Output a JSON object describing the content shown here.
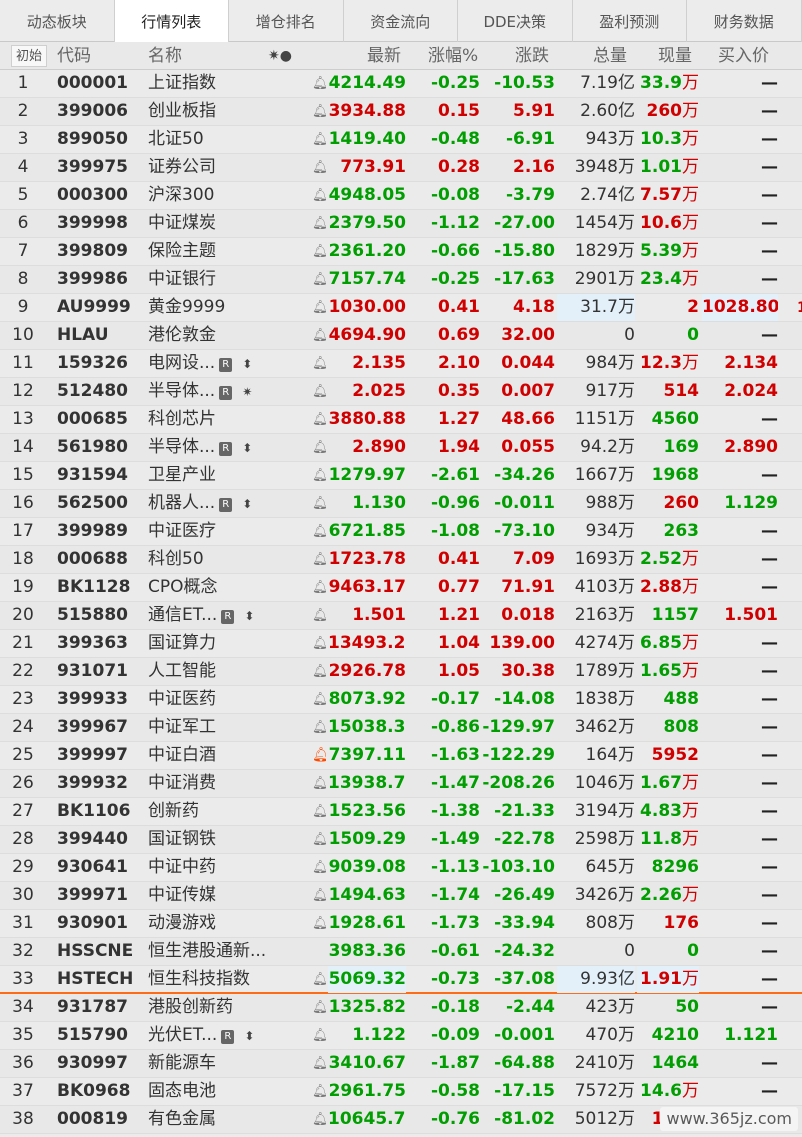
{
  "tabs": [
    {
      "label": "动态板块",
      "active": false
    },
    {
      "label": "行情列表",
      "active": true
    },
    {
      "label": "增仓排名",
      "active": false
    },
    {
      "label": "资金流向",
      "active": false
    },
    {
      "label": "DDE决策",
      "active": false
    },
    {
      "label": "盈利预测",
      "active": false
    },
    {
      "label": "财务数据",
      "active": false
    }
  ],
  "header": {
    "first": "初始",
    "code": "代码",
    "name": "名称",
    "marks": "✷●",
    "price": "最新",
    "pct": "涨幅%",
    "chg": "涨跌",
    "volume": "总量",
    "current": "现量",
    "bid": "买入价"
  },
  "colors": {
    "up": "#d00000",
    "down": "#009e00",
    "separator": "#ff6c17"
  },
  "icons": {
    "bell": "bell-icon",
    "badge": "r-badge-icon"
  },
  "rows": [
    {
      "idx": "1",
      "code": "000001",
      "name": "上证指数",
      "price": "4214.49",
      "pct": "-0.25",
      "chg": "-10.53",
      "vol": "7.19",
      "vol_unit": "亿",
      "cur": "33.9",
      "cur_unit": "万",
      "bid": "—",
      "dir": "down"
    },
    {
      "idx": "2",
      "code": "399006",
      "name": "创业板指",
      "price": "3934.88",
      "pct": "0.15",
      "chg": "5.91",
      "vol": "2.60",
      "vol_unit": "亿",
      "cur": "260",
      "cur_unit": "万",
      "bid": "—",
      "dir": "up"
    },
    {
      "idx": "3",
      "code": "899050",
      "name": "北证50",
      "price": "1419.40",
      "pct": "-0.48",
      "chg": "-6.91",
      "vol": "943",
      "vol_unit": "万",
      "cur": "10.3",
      "cur_unit": "万",
      "bid": "—",
      "dir": "down"
    },
    {
      "idx": "4",
      "code": "399975",
      "name": "证券公司",
      "price": "773.91",
      "pct": "0.28",
      "chg": "2.16",
      "vol": "3948",
      "vol_unit": "万",
      "cur": "1.01",
      "cur_unit": "万",
      "bid": "—",
      "dir": "up"
    },
    {
      "idx": "5",
      "code": "000300",
      "name": "沪深300",
      "price": "4948.05",
      "pct": "-0.08",
      "chg": "-3.79",
      "vol": "2.74",
      "vol_unit": "亿",
      "cur": "7.57",
      "cur_unit": "万",
      "bid": "—",
      "dir": "down"
    },
    {
      "idx": "6",
      "code": "399998",
      "name": "中证煤炭",
      "price": "2379.50",
      "pct": "-1.12",
      "chg": "-27.00",
      "vol": "1454",
      "vol_unit": "万",
      "cur": "10.6",
      "cur_unit": "万",
      "bid": "—",
      "dir": "down"
    },
    {
      "idx": "7",
      "code": "399809",
      "name": "保险主题",
      "price": "2361.20",
      "pct": "-0.66",
      "chg": "-15.80",
      "vol": "1829",
      "vol_unit": "万",
      "cur": "5.39",
      "cur_unit": "万",
      "bid": "—",
      "dir": "down"
    },
    {
      "idx": "8",
      "code": "399986",
      "name": "中证银行",
      "price": "7157.74",
      "pct": "-0.25",
      "chg": "-17.63",
      "vol": "2901",
      "vol_unit": "万",
      "cur": "23.4",
      "cur_unit": "万",
      "bid": "—",
      "dir": "down"
    },
    {
      "idx": "9",
      "code": "AU9999",
      "name": "黄金9999",
      "price": "1030.00",
      "pct": "0.41",
      "chg": "4.18",
      "vol": "31.7",
      "vol_unit": "万",
      "cur": "2",
      "cur_unit": "",
      "bid": "1028.80",
      "dir": "up"
    },
    {
      "idx": "10",
      "code": "HLAU",
      "name": "港伦敦金",
      "price": "4694.90",
      "pct": "0.69",
      "chg": "32.00",
      "vol": "0",
      "vol_unit": "",
      "cur": "0",
      "cur_unit": "",
      "bid": "—",
      "dir": "up"
    },
    {
      "idx": "11",
      "code": "159326",
      "name": "电网设...",
      "badge": "R",
      "mark": "⬍",
      "price": "2.135",
      "pct": "2.10",
      "chg": "0.044",
      "vol": "984",
      "vol_unit": "万",
      "cur": "12.3",
      "cur_unit": "万",
      "bid": "2.134",
      "dir": "up"
    },
    {
      "idx": "12",
      "code": "512480",
      "name": "半导体...",
      "badge": "R",
      "mark": "✷",
      "price": "2.025",
      "pct": "0.35",
      "chg": "0.007",
      "vol": "917",
      "vol_unit": "万",
      "cur": "514",
      "cur_unit": "",
      "bid": "2.024",
      "dir": "up"
    },
    {
      "idx": "13",
      "code": "000685",
      "name": "科创芯片",
      "price": "3880.88",
      "pct": "1.27",
      "chg": "48.66",
      "vol": "1151",
      "vol_unit": "万",
      "cur": "4560",
      "cur_unit": "",
      "bid": "—",
      "dir": "up"
    },
    {
      "idx": "14",
      "code": "561980",
      "name": "半导体...",
      "badge": "R",
      "mark": "⬍",
      "price": "2.890",
      "pct": "1.94",
      "chg": "0.055",
      "vol": "94.2",
      "vol_unit": "万",
      "cur": "169",
      "cur_unit": "",
      "bid": "2.890",
      "dir": "up"
    },
    {
      "idx": "15",
      "code": "931594",
      "name": "卫星产业",
      "price": "1279.97",
      "pct": "-2.61",
      "chg": "-34.26",
      "vol": "1667",
      "vol_unit": "万",
      "cur": "1968",
      "cur_unit": "",
      "bid": "—",
      "dir": "down"
    },
    {
      "idx": "16",
      "code": "562500",
      "name": "机器人...",
      "badge": "R",
      "mark": "⬍",
      "price": "1.130",
      "pct": "-0.96",
      "chg": "-0.011",
      "vol": "988",
      "vol_unit": "万",
      "cur": "260",
      "cur_unit": "",
      "bid": "1.129",
      "dir": "down"
    },
    {
      "idx": "17",
      "code": "399989",
      "name": "中证医疗",
      "price": "6721.85",
      "pct": "-1.08",
      "chg": "-73.10",
      "vol": "934",
      "vol_unit": "万",
      "cur": "263",
      "cur_unit": "",
      "bid": "—",
      "dir": "down"
    },
    {
      "idx": "18",
      "code": "000688",
      "name": "科创50",
      "price": "1723.78",
      "pct": "0.41",
      "chg": "7.09",
      "vol": "1693",
      "vol_unit": "万",
      "cur": "2.52",
      "cur_unit": "万",
      "bid": "—",
      "dir": "up"
    },
    {
      "idx": "19",
      "code": "BK1128",
      "name": "CPO概念",
      "price": "9463.17",
      "pct": "0.77",
      "chg": "71.91",
      "vol": "4103",
      "vol_unit": "万",
      "cur": "2.88",
      "cur_unit": "万",
      "bid": "—",
      "dir": "up"
    },
    {
      "idx": "20",
      "code": "515880",
      "name": "通信ET...",
      "badge": "R",
      "mark": "⬍",
      "price": "1.501",
      "pct": "1.21",
      "chg": "0.018",
      "vol": "2163",
      "vol_unit": "万",
      "cur": "1157",
      "cur_unit": "",
      "bid": "1.501",
      "dir": "up"
    },
    {
      "idx": "21",
      "code": "399363",
      "name": "国证算力",
      "price": "13493.22",
      "pct": "1.04",
      "chg": "139.00",
      "vol": "4274",
      "vol_unit": "万",
      "cur": "6.85",
      "cur_unit": "万",
      "bid": "—",
      "dir": "up"
    },
    {
      "idx": "22",
      "code": "931071",
      "name": "人工智能",
      "price": "2926.78",
      "pct": "1.05",
      "chg": "30.38",
      "vol": "1789",
      "vol_unit": "万",
      "cur": "1.65",
      "cur_unit": "万",
      "bid": "—",
      "dir": "up"
    },
    {
      "idx": "23",
      "code": "399933",
      "name": "中证医药",
      "price": "8073.92",
      "pct": "-0.17",
      "chg": "-14.08",
      "vol": "1838",
      "vol_unit": "万",
      "cur": "488",
      "cur_unit": "",
      "bid": "—",
      "dir": "down"
    },
    {
      "idx": "24",
      "code": "399967",
      "name": "中证军工",
      "price": "15038.31",
      "pct": "-0.86",
      "chg": "-129.97",
      "vol": "3462",
      "vol_unit": "万",
      "cur": "808",
      "cur_unit": "",
      "bid": "—",
      "dir": "down"
    },
    {
      "idx": "25",
      "code": "399997",
      "name": "中证白酒",
      "price": "7397.11",
      "pct": "-1.63",
      "chg": "-122.29",
      "vol": "164",
      "vol_unit": "万",
      "cur": "5952",
      "cur_unit": "",
      "bid": "—",
      "dir": "down",
      "alert": true
    },
    {
      "idx": "26",
      "code": "399932",
      "name": "中证消费",
      "price": "13938.71",
      "pct": "-1.47",
      "chg": "-208.26",
      "vol": "1046",
      "vol_unit": "万",
      "cur": "1.67",
      "cur_unit": "万",
      "bid": "—",
      "dir": "down"
    },
    {
      "idx": "27",
      "code": "BK1106",
      "name": "创新药",
      "price": "1523.56",
      "pct": "-1.38",
      "chg": "-21.33",
      "vol": "3194",
      "vol_unit": "万",
      "cur": "4.83",
      "cur_unit": "万",
      "bid": "—",
      "dir": "down"
    },
    {
      "idx": "28",
      "code": "399440",
      "name": "国证钢铁",
      "price": "1509.29",
      "pct": "-1.49",
      "chg": "-22.78",
      "vol": "2598",
      "vol_unit": "万",
      "cur": "11.8",
      "cur_unit": "万",
      "bid": "—",
      "dir": "down"
    },
    {
      "idx": "29",
      "code": "930641",
      "name": "中证中药",
      "price": "9039.08",
      "pct": "-1.13",
      "chg": "-103.10",
      "vol": "645",
      "vol_unit": "万",
      "cur": "8296",
      "cur_unit": "",
      "bid": "—",
      "dir": "down"
    },
    {
      "idx": "30",
      "code": "399971",
      "name": "中证传媒",
      "price": "1494.63",
      "pct": "-1.74",
      "chg": "-26.49",
      "vol": "3426",
      "vol_unit": "万",
      "cur": "2.26",
      "cur_unit": "万",
      "bid": "—",
      "dir": "down"
    },
    {
      "idx": "31",
      "code": "930901",
      "name": "动漫游戏",
      "price": "1928.61",
      "pct": "-1.73",
      "chg": "-33.94",
      "vol": "808",
      "vol_unit": "万",
      "cur": "176",
      "cur_unit": "",
      "bid": "—",
      "dir": "down"
    },
    {
      "idx": "32",
      "code": "HSSCNE",
      "name": "恒生港股通新...",
      "price": "3983.36",
      "pct": "-0.61",
      "chg": "-24.32",
      "vol": "0",
      "vol_unit": "",
      "cur": "0",
      "cur_unit": "",
      "bid": "—",
      "dir": "down",
      "nobell": true
    },
    {
      "idx": "33",
      "code": "HSTECH",
      "name": "恒生科技指数",
      "price": "5069.32",
      "pct": "-0.73",
      "chg": "-37.08",
      "vol": "9.93",
      "vol_unit": "亿",
      "cur": "1.91",
      "cur_unit": "万",
      "bid": "—",
      "dir": "down",
      "hl": true,
      "sep": true
    },
    {
      "idx": "34",
      "code": "931787",
      "name": "港股创新药",
      "price": "1325.82",
      "pct": "-0.18",
      "chg": "-2.44",
      "vol": "423",
      "vol_unit": "万",
      "cur": "50",
      "cur_unit": "",
      "bid": "—",
      "dir": "down"
    },
    {
      "idx": "35",
      "code": "515790",
      "name": "光伏ET...",
      "badge": "R",
      "mark": "⬍",
      "price": "1.122",
      "pct": "-0.09",
      "chg": "-0.001",
      "vol": "470",
      "vol_unit": "万",
      "cur": "4210",
      "cur_unit": "",
      "bid": "1.121",
      "dir": "down"
    },
    {
      "idx": "36",
      "code": "930997",
      "name": "新能源车",
      "price": "3410.67",
      "pct": "-1.87",
      "chg": "-64.88",
      "vol": "2410",
      "vol_unit": "万",
      "cur": "1464",
      "cur_unit": "",
      "bid": "—",
      "dir": "down"
    },
    {
      "idx": "37",
      "code": "BK0968",
      "name": "固态电池",
      "price": "2961.75",
      "pct": "-0.58",
      "chg": "-17.15",
      "vol": "7572",
      "vol_unit": "万",
      "cur": "14.6",
      "cur_unit": "万",
      "bid": "—",
      "dir": "down"
    },
    {
      "idx": "38",
      "code": "000819",
      "name": "有色金属",
      "price": "10645.77",
      "pct": "-0.76",
      "chg": "-81.02",
      "vol": "5012",
      "vol_unit": "万",
      "cur": "1813",
      "cur_unit": "",
      "bid": "—",
      "dir": "down"
    }
  ],
  "cur_colors": {
    "1": "down",
    "2": "up",
    "3": "down",
    "4": "down",
    "5": "up",
    "6": "up",
    "7": "down",
    "8": "down",
    "9": "up",
    "10": "down",
    "11": "up",
    "12": "up",
    "13": "down",
    "14": "down",
    "15": "down",
    "16": "up",
    "17": "down",
    "18": "down",
    "19": "up",
    "20": "down",
    "21": "down",
    "22": "down",
    "23": "down",
    "24": "down",
    "25": "up",
    "26": "down",
    "27": "down",
    "28": "down",
    "29": "down",
    "30": "down",
    "31": "up",
    "32": "down",
    "33": "up",
    "34": "down",
    "35": "down",
    "36": "down",
    "37": "down",
    "38": "up"
  },
  "watermark": "www.365jz.com"
}
